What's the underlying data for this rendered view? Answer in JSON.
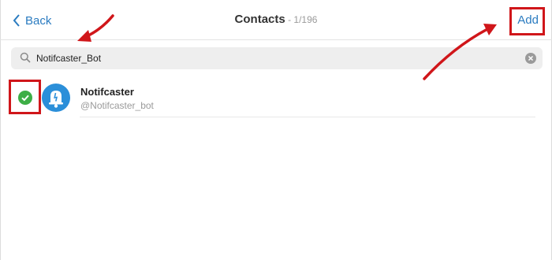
{
  "header": {
    "back_label": "Back",
    "title": "Contacts",
    "count": " - 1/196",
    "add_label": "Add"
  },
  "search": {
    "value": "Notifcaster_Bot"
  },
  "contacts": [
    {
      "name": "Notifcaster",
      "username": "@Notifcaster_bot",
      "selected": true
    }
  ],
  "colors": {
    "accent": "#2a7bc0",
    "check": "#3dae46",
    "avatar": "#2b8fd9",
    "annotation": "#d0161a"
  }
}
